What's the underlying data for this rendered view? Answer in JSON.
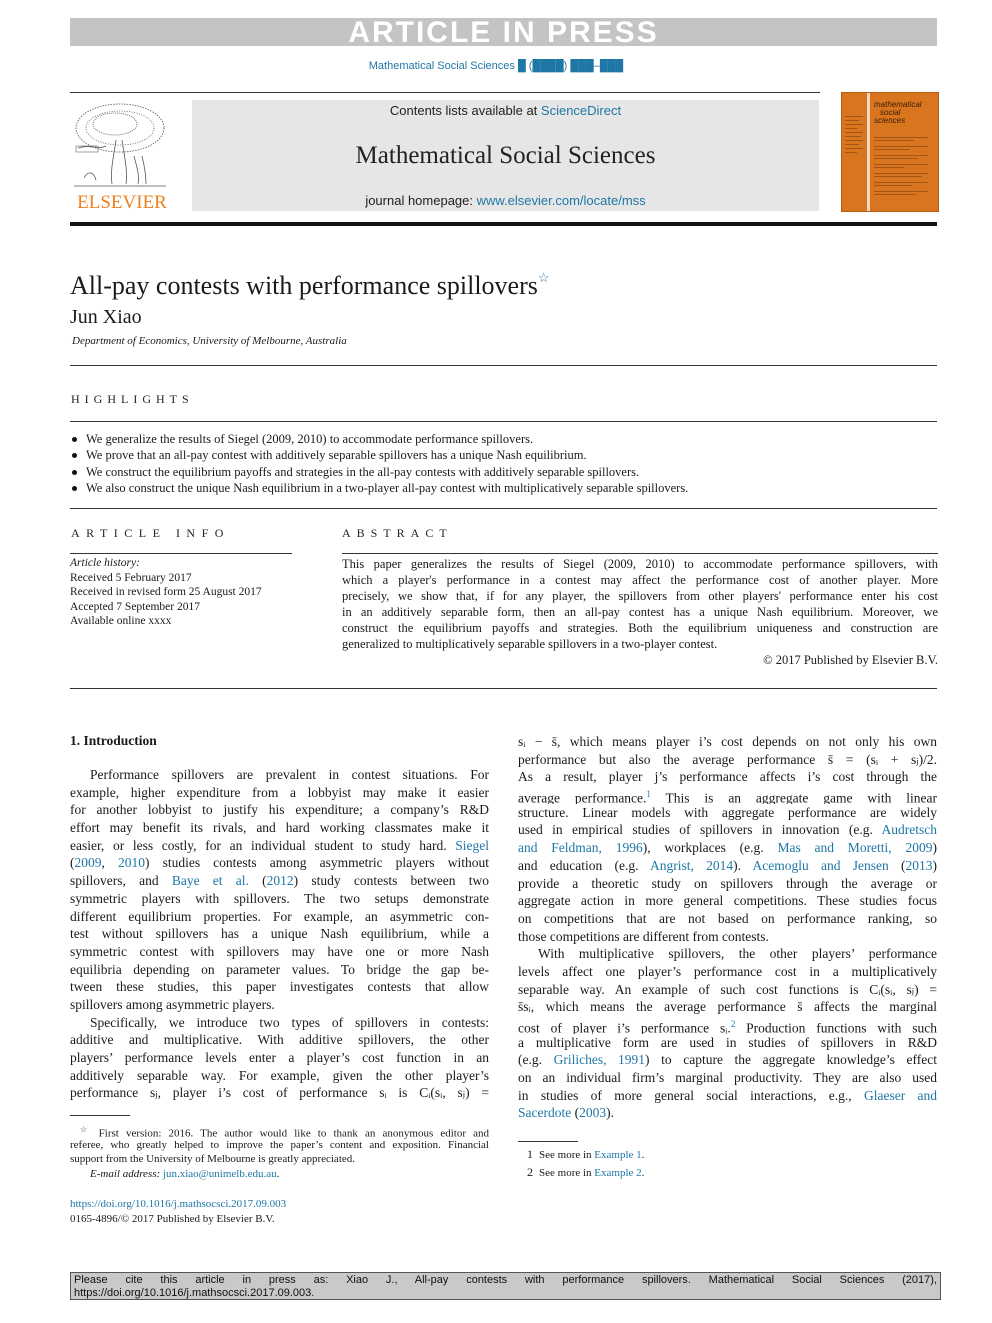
{
  "banner": {
    "text": "ARTICLE IN PRESS"
  },
  "journal_ref": "Mathematical Social Sciences █ (████) ███–███",
  "header": {
    "publisher_logo_text": "ELSEVIER",
    "contents_prefix": "Contents lists available at ",
    "contents_link": "ScienceDirect",
    "journal_name": "Mathematical Social Sciences",
    "homepage_prefix": "journal homepage: ",
    "homepage_link": "www.elsevier.com/locate/mss",
    "cover_title_lines": [
      "mathematical",
      "social",
      "sciences"
    ]
  },
  "article": {
    "title": "All-pay contests with performance spillovers",
    "title_mark": "☆",
    "author": "Jun Xiao",
    "affiliation": "Department of Economics, University of Melbourne, Australia"
  },
  "highlights": {
    "heading": "HIGHLIGHTS",
    "items": [
      "We generalize the results of Siegel (2009, 2010) to accommodate performance spillovers.",
      "We prove that an all-pay contest with additively separable spillovers has a unique Nash equilibrium.",
      "We construct the equilibrium payoffs and strategies in the all-pay contests with additively separable spillovers.",
      "We also construct the unique Nash equilibrium in a two-player all-pay contest with multiplicatively separable spillovers."
    ]
  },
  "article_info": {
    "heading": "ARTICLE INFO",
    "history_label": "Article history:",
    "history": [
      "Received 5 February 2017",
      "Received in revised form 25 August 2017",
      "Accepted 7 September 2017",
      "Available online xxxx"
    ]
  },
  "abstract": {
    "heading": "ABSTRACT",
    "lines": [
      "This paper generalizes the results of Siegel (2009, 2010) to accommodate performance spillovers, with",
      "which a player's performance in a contest may affect the performance cost of another player. More",
      "precisely, we show that, if for any player, the spillovers from other players' performance enter his cost",
      "in an additively separable form, then an all-pay contest has a unique Nash equilibrium. Moreover, we",
      "construct the equilibrium payoffs and strategies. Both the equilibrium uniqueness and construction are",
      "generalized to multiplicatively separable spillovers in a two-player contest."
    ],
    "copyright": "© 2017 Published by Elsevier B.V."
  },
  "intro": {
    "heading": "1.  Introduction",
    "left_lines": [
      "Performance spillovers are prevalent in contest situations. For",
      "example, higher expenditure from a lobbyist may make it easier",
      "for another lobbyist to justify his expenditure; a company’s R&D",
      "effort may benefit its rivals, and hard working classmates make it",
      "easier, or less costly, for an individual student to study hard."
    ],
    "link_siegel": "Siegel",
    "link_2009": "2009",
    "link_2010": "2010",
    "siegel_rest": ") studies contests among asymmetric players without",
    "spill_and": "spillovers, and ",
    "link_baye": "Baye et al.",
    "link_2012": "2012",
    "baye_rest": ") study contests between two",
    "left_lines2": [
      "symmetric players with spillovers. The two setups demonstrate",
      "different equilibrium properties. For example, an asymmetric con-",
      "test without spillovers has a unique Nash equilibrium, while a",
      "symmetric contest with spillovers may have one or more Nash",
      "equilibria depending on parameter values. To bridge the gap be-",
      "tween these studies, this paper investigates contests that allow",
      "spillovers among asymmetric players."
    ],
    "para2_lines": [
      "Specifically, we introduce two types of spillovers in contests:",
      "additive and multiplicative. With additive spillovers, the other",
      "players’ performance levels enter a player’s cost function in an",
      "additively separable way. For example, given the other player’s"
    ],
    "para2_last": "performance sⱼ, player i’s cost of performance sᵢ is Cᵢ(sᵢ, sⱼ)  =",
    "right": {
      "r1": "sᵢ − s̄, which means player i’s cost depends on not only his own",
      "r2": "performance but also the average performance s̄  =  (sᵢ + sⱼ)/2.",
      "r3": "As a result, player j’s performance affects i’s cost through the",
      "r4a": "average performance.",
      "r4_fn": "1",
      "r4b": "  This is an aggregate game with linear",
      "r5": "structure. Linear models with aggregate performance are widely",
      "r6a": "used in empirical studies of spillovers in innovation (e.g. ",
      "r6_link": "Audretsch",
      "r7_link": "and Feldman, 1996",
      "r7b": "), workplaces (e.g.  ",
      "r7_link2": "Mas and Moretti, 2009",
      "r7c": ")",
      "r8a": "and education (e.g.  ",
      "r8_link": "Angrist, 2014",
      "r8b": "). ",
      "r8_link2": "Acemoglu and Jensen",
      "r8c": " (",
      "r8_link3": "2013",
      "r8d": ")",
      "r9": "provide a theoretic study on spillovers through the average or",
      "r10": "aggregate action in more general competitions. These studies focus",
      "r11": "on competitions that are not based on performance ranking, so",
      "r12": "those competitions are different from contests.",
      "p2": [
        "With multiplicative spillovers, the other players’ performance",
        "levels affect one player’s performance cost in a multiplicatively",
        "separable way. An example of such cost functions is Cᵢ(sᵢ, sⱼ)  ="
      ],
      "p2_l4": "s̄sᵢ, which means the average performance s̄ affects the marginal",
      "p2_l5a": "cost of player i’s performance sᵢ.",
      "p2_l5_fn": "2",
      "p2_l5b": "  Production functions with such",
      "p2_l6": "a multiplicative form are used in studies of spillovers in R&D",
      "p2_l7a": "(e.g.  ",
      "p2_l7_link": "Griliches, 1991",
      "p2_l7b": ") to capture the aggregate knowledge’s effect",
      "p2_l8": "on an individual firm’s marginal productivity. They are also used",
      "p2_l9a": "in studies of more general social interactions, e.g.,  ",
      "p2_l9_link": "Glaeser and",
      "p2_l10_link": "Sacerdote",
      "p2_l10b": " (",
      "p2_l10_link2": "2003",
      "p2_l10c": ")."
    }
  },
  "footnotes_left": {
    "star_mark": "☆",
    "star_lines": [
      " First version: 2016. The author would like to thank an anonymous editor and",
      "referee, who greatly helped to improve the paper’s content and exposition. Financial",
      "support from the University of Melbourne is greatly appreciated."
    ],
    "email_label": "E-mail address: ",
    "email": "jun.xiao@unimelb.edu.au",
    "email_end": ".",
    "doi": "https://doi.org/10.1016/j.mathsocsci.2017.09.003",
    "issn": "0165-4896/© 2017 Published by Elsevier B.V."
  },
  "footnotes_right": [
    {
      "num": "1",
      "prefix": "See more in ",
      "link": "Example 1",
      "suffix": "."
    },
    {
      "num": "2",
      "prefix": "See more in ",
      "link": "Example 2",
      "suffix": "."
    }
  ],
  "cite_box": {
    "line1": "Please cite this article in press as: Xiao J., All-pay contests with performance spillovers. Mathematical Social Sciences (2017),",
    "line2": "https://doi.org/10.1016/j.mathsocsci.2017.09.003."
  },
  "colors": {
    "link": "#1f77a6",
    "elsevier_orange": "#f07f1c",
    "banner_gray": "#c4c4c4",
    "cover_orange": "#d9741f"
  }
}
